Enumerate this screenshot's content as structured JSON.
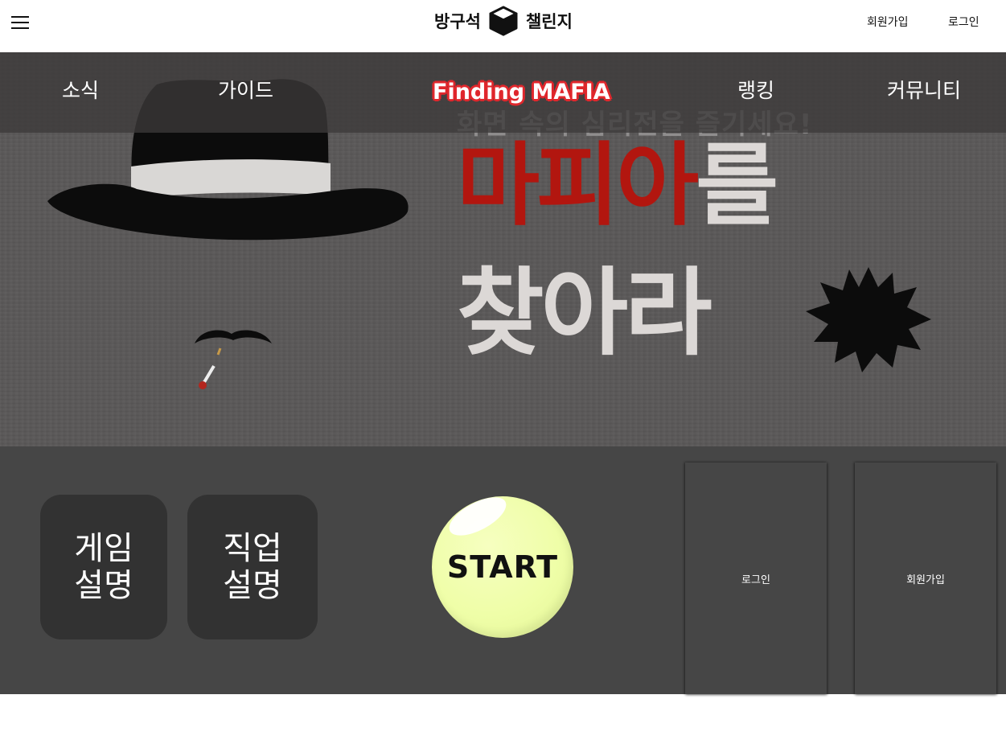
{
  "header": {
    "logo_left": "방구석",
    "logo_right": "챌린지",
    "signup": "회원가입",
    "login": "로그인"
  },
  "nav": {
    "news": "소식",
    "guide": "가이드",
    "title": "Finding MAFIA",
    "ranking": "랭킹",
    "community": "커뮤니티"
  },
  "banner": {
    "subtitle": "화면 속의 심리전을 즐기세요!",
    "headline_red": "마피아",
    "headline_suffix": "를",
    "headline2": "찾아라"
  },
  "panel": {
    "game_line1": "게임",
    "game_line2": "설명",
    "job_line1": "직업",
    "job_line2": "설명",
    "start": "START",
    "login": "로그인",
    "signup": "회원가입"
  },
  "colors": {
    "banner_red": "#b2160f",
    "title_outline": "#e0272c",
    "start_ball": "#effea8",
    "panel_bg": "#464646",
    "tile_bg": "#323232"
  },
  "icons": [
    "menu-icon",
    "cube-icon",
    "hat-image",
    "mustache-image",
    "cigarette-image",
    "bullet-hole-image"
  ]
}
